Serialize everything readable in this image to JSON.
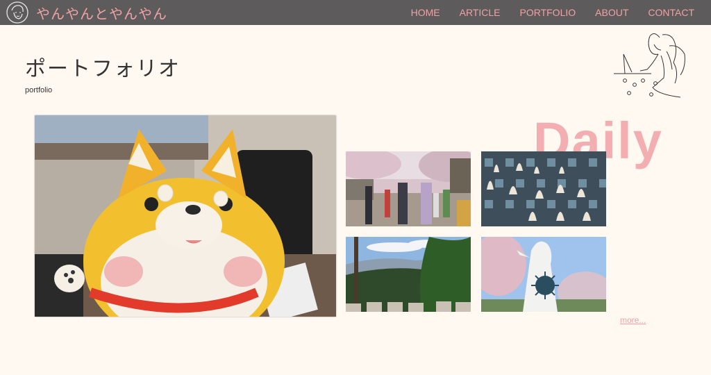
{
  "header": {
    "site_title": "やんやんとやんやん",
    "nav": [
      {
        "label": "HOME"
      },
      {
        "label": "ARTICLE"
      },
      {
        "label": "PORTFOLIO"
      },
      {
        "label": "ABOUT"
      },
      {
        "label": "CONTACT"
      }
    ]
  },
  "main": {
    "title": "ポートフォリオ",
    "subtitle": "portfolio",
    "daily_label": "Daily",
    "more_link": "more..."
  },
  "colors": {
    "header_bg": "#5d5b5b",
    "accent": "#f0a2a6",
    "page_bg": "#fff9f2"
  }
}
